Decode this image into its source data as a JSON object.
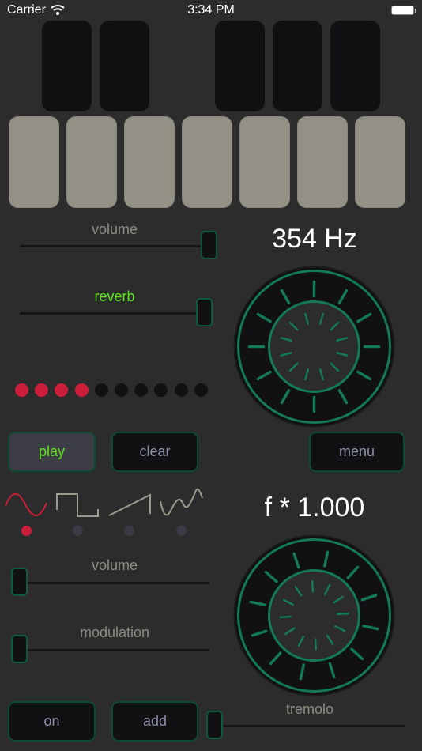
{
  "status_bar": {
    "carrier": "Carrier",
    "time": "3:34 PM",
    "battery_level": 1.0
  },
  "keyboard": {
    "black_keys": 5,
    "white_keys": 7
  },
  "top_panel": {
    "volume": {
      "label": "volume",
      "value": 1.0,
      "label_color": "#8e8b82"
    },
    "reverb": {
      "label": "reverb",
      "value": 0.96,
      "label_color": "#5ee81c"
    },
    "step_dots": {
      "total": 10,
      "active": 4,
      "active_color": "#cc1e3a",
      "inactive_color": "#111114"
    },
    "frequency_readout": "354 Hz",
    "frequency_knob": {
      "rotation_deg": 0
    }
  },
  "buttons": {
    "play": "play",
    "clear": "clear",
    "menu": "menu",
    "on": "on",
    "add": "add"
  },
  "waveforms": {
    "items": [
      {
        "name": "sine",
        "selected": true
      },
      {
        "name": "square",
        "selected": false
      },
      {
        "name": "sawtooth",
        "selected": false
      },
      {
        "name": "custom",
        "selected": false
      }
    ],
    "selected_color": "#cc1e3a",
    "unselected_color": "#3b3b46",
    "selected_stroke": "#c81e38",
    "unselected_stroke": "#9c998e"
  },
  "bottom_panel": {
    "multiplier_readout": "f * 1.000",
    "multiplier_knob": {
      "rotation_deg": 12
    },
    "volume": {
      "label": "volume",
      "value": 0.0
    },
    "modulation": {
      "label": "modulation",
      "value": 0.0
    },
    "tremolo": {
      "label": "tremolo",
      "value": 0.0
    }
  },
  "colors": {
    "background": "#2c2c2c",
    "accent_green": "#137a55",
    "black_key": "#111114",
    "white_key": "#939085"
  }
}
